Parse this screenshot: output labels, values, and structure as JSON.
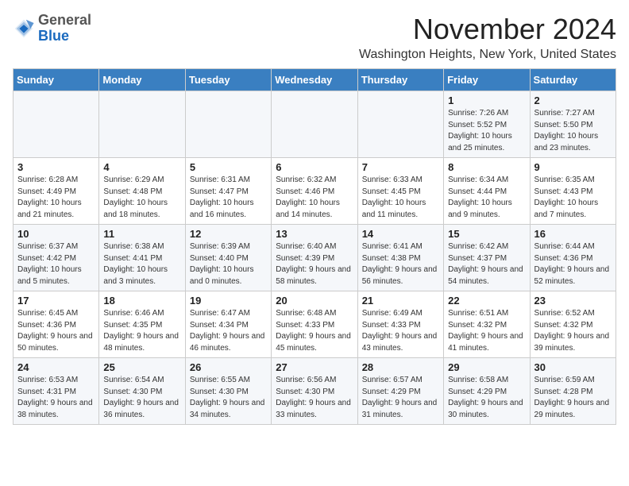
{
  "logo": {
    "general": "General",
    "blue": "Blue"
  },
  "header": {
    "month": "November 2024",
    "location": "Washington Heights, New York, United States"
  },
  "weekdays": [
    "Sunday",
    "Monday",
    "Tuesday",
    "Wednesday",
    "Thursday",
    "Friday",
    "Saturday"
  ],
  "weeks": [
    [
      {
        "day": "",
        "info": ""
      },
      {
        "day": "",
        "info": ""
      },
      {
        "day": "",
        "info": ""
      },
      {
        "day": "",
        "info": ""
      },
      {
        "day": "",
        "info": ""
      },
      {
        "day": "1",
        "info": "Sunrise: 7:26 AM\nSunset: 5:52 PM\nDaylight: 10 hours and 25 minutes."
      },
      {
        "day": "2",
        "info": "Sunrise: 7:27 AM\nSunset: 5:50 PM\nDaylight: 10 hours and 23 minutes."
      }
    ],
    [
      {
        "day": "3",
        "info": "Sunrise: 6:28 AM\nSunset: 4:49 PM\nDaylight: 10 hours and 21 minutes."
      },
      {
        "day": "4",
        "info": "Sunrise: 6:29 AM\nSunset: 4:48 PM\nDaylight: 10 hours and 18 minutes."
      },
      {
        "day": "5",
        "info": "Sunrise: 6:31 AM\nSunset: 4:47 PM\nDaylight: 10 hours and 16 minutes."
      },
      {
        "day": "6",
        "info": "Sunrise: 6:32 AM\nSunset: 4:46 PM\nDaylight: 10 hours and 14 minutes."
      },
      {
        "day": "7",
        "info": "Sunrise: 6:33 AM\nSunset: 4:45 PM\nDaylight: 10 hours and 11 minutes."
      },
      {
        "day": "8",
        "info": "Sunrise: 6:34 AM\nSunset: 4:44 PM\nDaylight: 10 hours and 9 minutes."
      },
      {
        "day": "9",
        "info": "Sunrise: 6:35 AM\nSunset: 4:43 PM\nDaylight: 10 hours and 7 minutes."
      }
    ],
    [
      {
        "day": "10",
        "info": "Sunrise: 6:37 AM\nSunset: 4:42 PM\nDaylight: 10 hours and 5 minutes."
      },
      {
        "day": "11",
        "info": "Sunrise: 6:38 AM\nSunset: 4:41 PM\nDaylight: 10 hours and 3 minutes."
      },
      {
        "day": "12",
        "info": "Sunrise: 6:39 AM\nSunset: 4:40 PM\nDaylight: 10 hours and 0 minutes."
      },
      {
        "day": "13",
        "info": "Sunrise: 6:40 AM\nSunset: 4:39 PM\nDaylight: 9 hours and 58 minutes."
      },
      {
        "day": "14",
        "info": "Sunrise: 6:41 AM\nSunset: 4:38 PM\nDaylight: 9 hours and 56 minutes."
      },
      {
        "day": "15",
        "info": "Sunrise: 6:42 AM\nSunset: 4:37 PM\nDaylight: 9 hours and 54 minutes."
      },
      {
        "day": "16",
        "info": "Sunrise: 6:44 AM\nSunset: 4:36 PM\nDaylight: 9 hours and 52 minutes."
      }
    ],
    [
      {
        "day": "17",
        "info": "Sunrise: 6:45 AM\nSunset: 4:36 PM\nDaylight: 9 hours and 50 minutes."
      },
      {
        "day": "18",
        "info": "Sunrise: 6:46 AM\nSunset: 4:35 PM\nDaylight: 9 hours and 48 minutes."
      },
      {
        "day": "19",
        "info": "Sunrise: 6:47 AM\nSunset: 4:34 PM\nDaylight: 9 hours and 46 minutes."
      },
      {
        "day": "20",
        "info": "Sunrise: 6:48 AM\nSunset: 4:33 PM\nDaylight: 9 hours and 45 minutes."
      },
      {
        "day": "21",
        "info": "Sunrise: 6:49 AM\nSunset: 4:33 PM\nDaylight: 9 hours and 43 minutes."
      },
      {
        "day": "22",
        "info": "Sunrise: 6:51 AM\nSunset: 4:32 PM\nDaylight: 9 hours and 41 minutes."
      },
      {
        "day": "23",
        "info": "Sunrise: 6:52 AM\nSunset: 4:32 PM\nDaylight: 9 hours and 39 minutes."
      }
    ],
    [
      {
        "day": "24",
        "info": "Sunrise: 6:53 AM\nSunset: 4:31 PM\nDaylight: 9 hours and 38 minutes."
      },
      {
        "day": "25",
        "info": "Sunrise: 6:54 AM\nSunset: 4:30 PM\nDaylight: 9 hours and 36 minutes."
      },
      {
        "day": "26",
        "info": "Sunrise: 6:55 AM\nSunset: 4:30 PM\nDaylight: 9 hours and 34 minutes."
      },
      {
        "day": "27",
        "info": "Sunrise: 6:56 AM\nSunset: 4:30 PM\nDaylight: 9 hours and 33 minutes."
      },
      {
        "day": "28",
        "info": "Sunrise: 6:57 AM\nSunset: 4:29 PM\nDaylight: 9 hours and 31 minutes."
      },
      {
        "day": "29",
        "info": "Sunrise: 6:58 AM\nSunset: 4:29 PM\nDaylight: 9 hours and 30 minutes."
      },
      {
        "day": "30",
        "info": "Sunrise: 6:59 AM\nSunset: 4:28 PM\nDaylight: 9 hours and 29 minutes."
      }
    ]
  ]
}
